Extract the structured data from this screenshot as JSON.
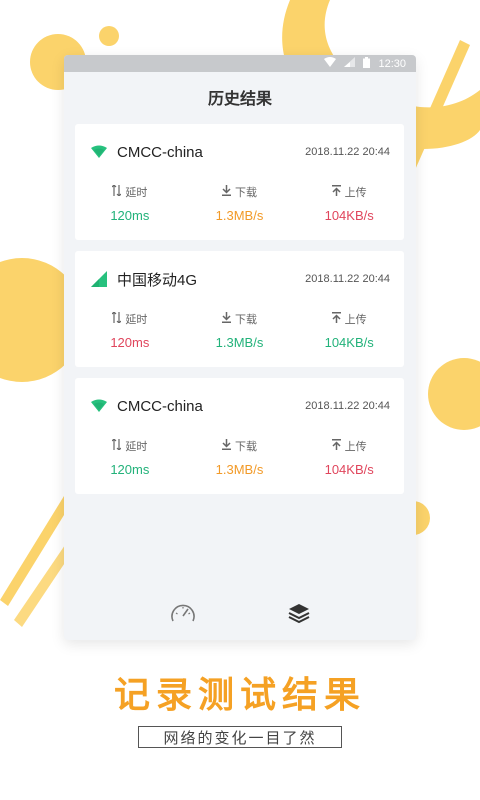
{
  "status_bar": {
    "time": "12:30"
  },
  "header": {
    "title": "历史结果"
  },
  "records": [
    {
      "network_icon": "wifi-icon",
      "network": "CMCC-china",
      "timestamp": "2018.11.22 20:44",
      "metrics": [
        {
          "icon": "latency-icon",
          "label": "延时",
          "value": "120ms"
        },
        {
          "icon": "download-icon",
          "label": "下载",
          "value": "1.3MB/s"
        },
        {
          "icon": "upload-icon",
          "label": "上传",
          "value": "104KB/s"
        }
      ]
    },
    {
      "network_icon": "cellular-signal-icon",
      "network": "中国移动4G",
      "timestamp": "2018.11.22 20:44",
      "metrics": [
        {
          "icon": "latency-icon",
          "label": "延时",
          "value": "120ms"
        },
        {
          "icon": "download-icon",
          "label": "下载",
          "value": "1.3MB/s"
        },
        {
          "icon": "upload-icon",
          "label": "上传",
          "value": "104KB/s"
        }
      ]
    },
    {
      "network_icon": "wifi-icon",
      "network": "CMCC-china",
      "timestamp": "2018.11.22 20:44",
      "metrics": [
        {
          "icon": "latency-icon",
          "label": "延时",
          "value": "120ms"
        },
        {
          "icon": "download-icon",
          "label": "下载",
          "value": "1.3MB/s"
        },
        {
          "icon": "upload-icon",
          "label": "上传",
          "value": "104KB/s"
        }
      ]
    }
  ],
  "tab_bar": {
    "tabs": [
      "speedometer-icon",
      "layers-icon"
    ],
    "active": "layers-icon"
  },
  "promo": {
    "slogan": "记录测试结果",
    "subtitle": "网络的变化一目了然"
  },
  "colors": {
    "accent": "#f5a124",
    "decor_yellow": "#fbd36b",
    "good": "#22b27a",
    "mid": "#f29a28",
    "bad": "#e0455c",
    "wifi_green": "#27c17e"
  }
}
